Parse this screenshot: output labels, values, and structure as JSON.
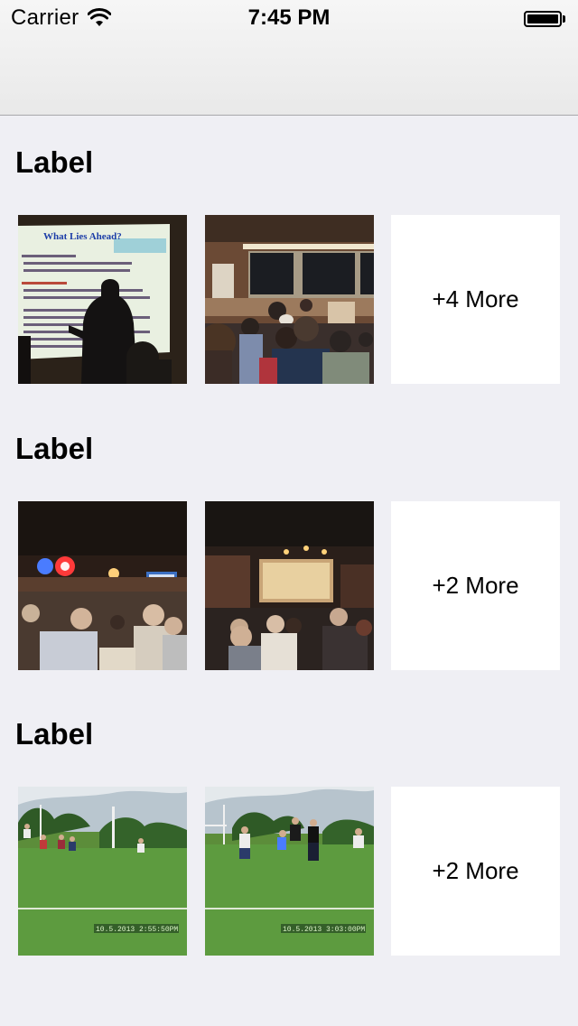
{
  "status_bar": {
    "carrier": "Carrier",
    "time": "7:45 PM",
    "wifi_icon": "wifi-icon",
    "battery_icon": "battery-icon"
  },
  "sections": [
    {
      "title": "Label",
      "more_label": "+4 More",
      "photos": [
        {
          "icon": "photo-presentation-slide",
          "slide_title": "What Lies Ahead?"
        },
        {
          "icon": "photo-lecture-hall-audience"
        }
      ]
    },
    {
      "title": "Label",
      "more_label": "+2 More",
      "photos": [
        {
          "icon": "photo-bar-crowd"
        },
        {
          "icon": "photo-bar-screen-crowd"
        }
      ]
    },
    {
      "title": "Label",
      "more_label": "+2 More",
      "photos": [
        {
          "icon": "photo-field-game",
          "timestamp": "10.5.2013 2:55:50PM"
        },
        {
          "icon": "photo-field-game",
          "timestamp": "10.5.2013 3:03:00PM"
        }
      ]
    }
  ],
  "colors": {
    "background": "#efeff4",
    "nav_bar": "#f6f6f6",
    "tile": "#ffffff"
  }
}
